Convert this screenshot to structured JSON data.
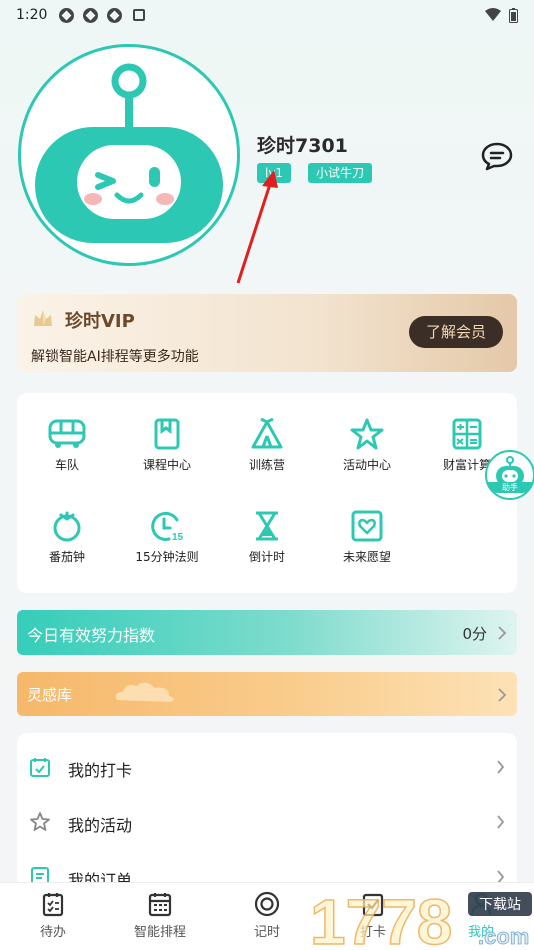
{
  "status_bar": {
    "time": "1:20"
  },
  "profile": {
    "username": "珍时7301",
    "level_tag": "lv1",
    "title_tag": "小试牛刀"
  },
  "vip": {
    "title": "珍时VIP",
    "subtitle": "解锁智能AI排程等更多功能",
    "button": "了解会员"
  },
  "features": [
    {
      "label": "车队",
      "icon": "bus-icon"
    },
    {
      "label": "课程中心",
      "icon": "book-icon"
    },
    {
      "label": "训练营",
      "icon": "tent-icon"
    },
    {
      "label": "活动中心",
      "icon": "star-icon"
    },
    {
      "label": "财富计算",
      "icon": "calculator-icon"
    },
    {
      "label": "番茄钟",
      "icon": "tomato-icon"
    },
    {
      "label": "15分钟法则",
      "icon": "clock-15-icon"
    },
    {
      "label": "倒计时",
      "icon": "hourglass-icon"
    },
    {
      "label": "未来愿望",
      "icon": "heart-card-icon"
    }
  ],
  "helper": {
    "label": "助手"
  },
  "effort": {
    "label": "今日有效努力指数",
    "score": "0分"
  },
  "inspiration": {
    "label": "灵感库"
  },
  "list": [
    {
      "label": "我的打卡",
      "icon": "calendar-check-icon"
    },
    {
      "label": "我的活动",
      "icon": "star-outline-icon"
    },
    {
      "label": "我的订单",
      "icon": "order-icon"
    }
  ],
  "bottom_nav": [
    {
      "label": "待办",
      "icon": "todo-icon"
    },
    {
      "label": "智能排程",
      "icon": "schedule-icon"
    },
    {
      "label": "记时",
      "icon": "target-icon"
    },
    {
      "label": "打卡",
      "icon": "checkin-icon"
    },
    {
      "label": "我的",
      "icon": "user-icon"
    }
  ],
  "watermark": {
    "text": "1778",
    "badge": "下载站",
    "suffix": ".com"
  },
  "colors": {
    "accent": "#2cc8b4",
    "vip_dark": "#3b2e26",
    "arrow": "#e02020"
  }
}
